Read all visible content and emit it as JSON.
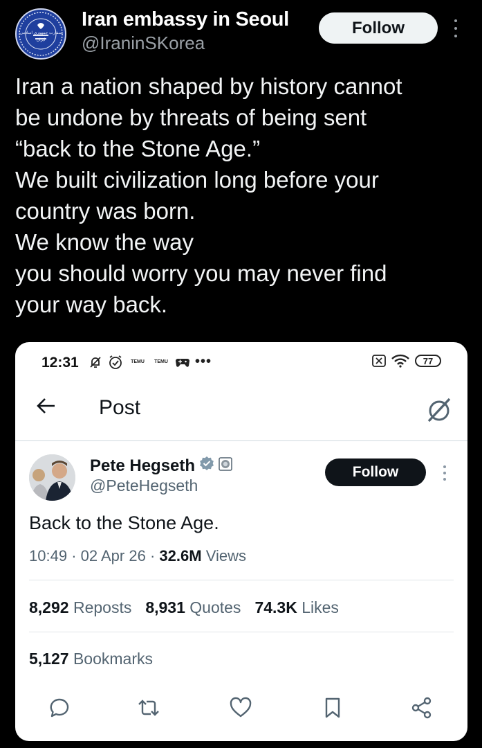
{
  "outer": {
    "avatar_seal_text": "سفارت جمهوری اسلامی ایران",
    "name": "Iran embassy in Seoul",
    "handle": "@IraninSKorea",
    "follow_label": "Follow",
    "tweet_lines": [
      "Iran a nation shaped by history cannot",
      "be undone by threats of being sent",
      "“back to the Stone Age.”",
      "We built civilization long before your",
      "country was born.",
      "We know the way",
      "you should worry you may never find",
      "your way back."
    ]
  },
  "embedded": {
    "status_bar": {
      "time": "12:31",
      "temu_label": "TEMU",
      "battery": "77"
    },
    "header": {
      "title": "Post"
    },
    "author": {
      "name": "Pete Hegseth",
      "handle": "@PeteHegseth",
      "follow_label": "Follow"
    },
    "post_text": "Back to the Stone Age.",
    "meta": {
      "time": "10:49",
      "date": "02 Apr 26",
      "views_count": "32.6M",
      "views_label": "Views"
    },
    "stats": {
      "reposts_count": "8,292",
      "reposts_label": "Reposts",
      "quotes_count": "8,931",
      "quotes_label": "Quotes",
      "likes_count": "74.3K",
      "likes_label": "Likes",
      "bookmarks_count": "5,127",
      "bookmarks_label": "Bookmarks"
    },
    "colors": {
      "verified_badge": "#829aab",
      "text_primary": "#0f1419",
      "text_secondary": "#536471"
    }
  }
}
